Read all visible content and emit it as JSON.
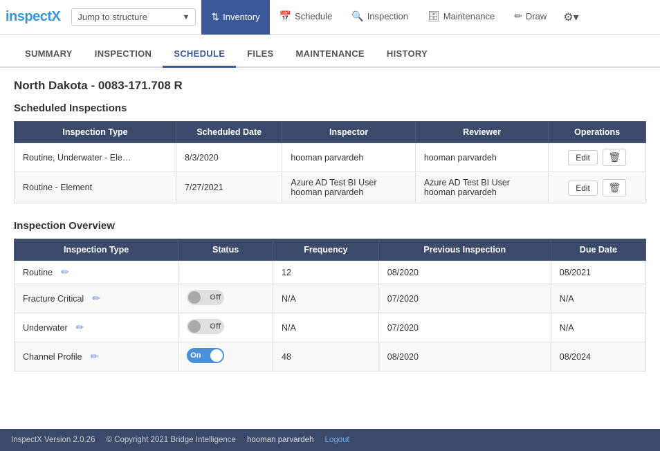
{
  "app": {
    "logo_part1": "inspect",
    "logo_part2": "X"
  },
  "top_nav": {
    "jump_label": "Jump to structure",
    "items": [
      {
        "id": "inventory",
        "label": "Inventory",
        "icon": "⇅",
        "active": true
      },
      {
        "id": "schedule",
        "label": "Schedule",
        "icon": "📅",
        "active": false
      },
      {
        "id": "inspection",
        "label": "Inspection",
        "icon": "🔍",
        "active": false
      },
      {
        "id": "maintenance",
        "label": "Maintenance",
        "icon": "🗄",
        "active": false
      },
      {
        "id": "draw",
        "label": "Draw",
        "icon": "✏",
        "active": false
      }
    ],
    "settings_icon": "⚙"
  },
  "sub_tabs": [
    {
      "id": "summary",
      "label": "SUMMARY",
      "active": false
    },
    {
      "id": "inspection",
      "label": "INSPECTION",
      "active": false
    },
    {
      "id": "schedule",
      "label": "SCHEDULE",
      "active": true
    },
    {
      "id": "files",
      "label": "FILES",
      "active": false
    },
    {
      "id": "maintenance",
      "label": "MAINTENANCE",
      "active": false
    },
    {
      "id": "history",
      "label": "HISTORY",
      "active": false
    }
  ],
  "page": {
    "title": "North Dakota - 0083-171.708 R",
    "scheduled_inspections_title": "Scheduled Inspections",
    "inspection_overview_title": "Inspection Overview"
  },
  "scheduled_table": {
    "headers": [
      "Inspection Type",
      "Scheduled Date",
      "Inspector",
      "Reviewer",
      "Operations"
    ],
    "rows": [
      {
        "type": "Routine, Underwater - Ele…",
        "date": "8/3/2020",
        "inspector": "hooman parvardeh",
        "reviewer": "hooman parvardeh"
      },
      {
        "type": "Routine - Element",
        "date": "7/27/2021",
        "inspector_line1": "Azure AD Test BI User",
        "inspector_line2": "hooman parvardeh",
        "reviewer_line1": "Azure AD Test BI User",
        "reviewer_line2": "hooman parvardeh"
      }
    ],
    "edit_label": "Edit",
    "delete_icon": "🗑"
  },
  "overview_table": {
    "headers": [
      "Inspection Type",
      "Status",
      "Frequency",
      "Previous Inspection",
      "Due Date"
    ],
    "rows": [
      {
        "type": "Routine",
        "status_type": "none",
        "frequency": "12",
        "previous": "08/2020",
        "due": "08/2021"
      },
      {
        "type": "Fracture Critical",
        "status_type": "off",
        "frequency": "N/A",
        "previous": "07/2020",
        "due": "N/A"
      },
      {
        "type": "Underwater",
        "status_type": "off",
        "frequency": "N/A",
        "previous": "07/2020",
        "due": "N/A"
      },
      {
        "type": "Channel Profile",
        "status_type": "on",
        "frequency": "48",
        "previous": "08/2020",
        "due": "08/2024"
      }
    ],
    "toggle_off_label": "Off",
    "toggle_on_label": "On"
  },
  "footer": {
    "version": "InspectX Version 2.0.26",
    "copyright": "© Copyright 2021 Bridge Intelligence",
    "user": "hooman parvardeh",
    "logout": "Logout"
  }
}
